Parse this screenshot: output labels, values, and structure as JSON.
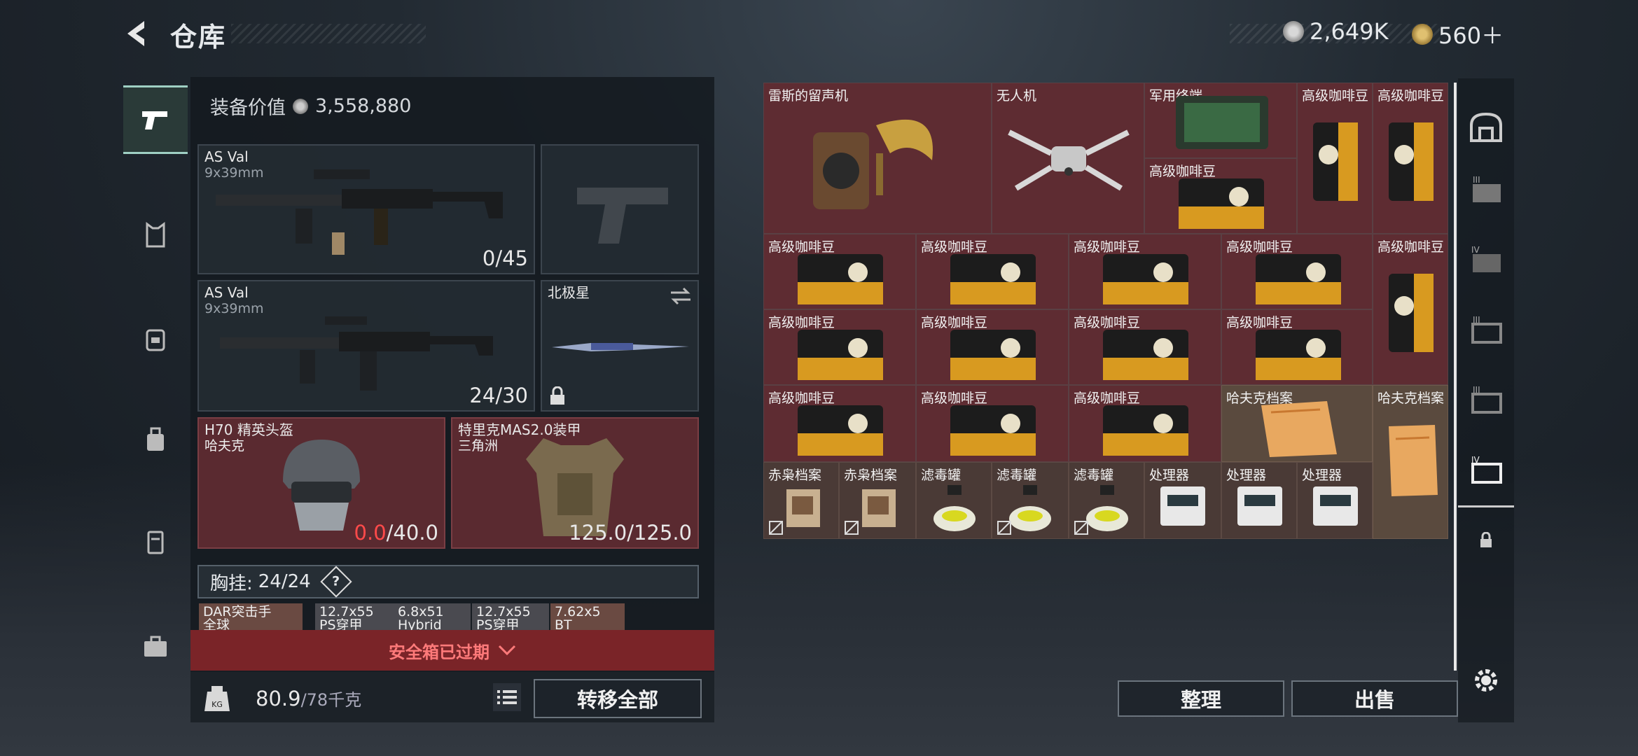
{
  "header": {
    "title": "仓库",
    "currency1": "2,649K",
    "currency2": "560＋"
  },
  "left": {
    "equip_label": "装备价值",
    "equip_value": "3,558,880",
    "weapon1": {
      "name": "AS Val",
      "caliber": "9x39mm",
      "ammo": "0/45"
    },
    "weapon2": {
      "name": "AS Val",
      "caliber": "9x39mm",
      "ammo": "24/30"
    },
    "melee": {
      "name": "北极星"
    },
    "helmet": {
      "name": "H70 精英头盔",
      "sub": "哈夫克",
      "dur_cur": "0.0",
      "dur_max": "/40.0"
    },
    "armor": {
      "name": "特里克MAS2.0装甲",
      "sub": "三角洲",
      "dur": "125.0/125.0"
    },
    "rig": {
      "label": "胸挂:",
      "count": "24/24",
      "help": "?"
    },
    "rig_items": [
      {
        "l1": "DAR突击手",
        "l2": "全球"
      },
      {
        "l1": "12.7x55",
        "l2": "PS穿甲"
      },
      {
        "l1": "6.8x51",
        "l2": "Hybrid"
      },
      {
        "l1": "12.7x55",
        "l2": "PS穿甲"
      },
      {
        "l1": "7.62x5",
        "l2": "BT"
      }
    ],
    "expired": "安全箱已过期",
    "weight": "80.9",
    "weight_max": "/78千克",
    "transfer_all": "转移全部"
  },
  "grid": {
    "items": [
      {
        "name": "雷斯的留声机",
        "kind": "gramophone"
      },
      {
        "name": "无人机",
        "kind": "drone"
      },
      {
        "name": "军用终端",
        "kind": "terminal"
      },
      {
        "name": "高级咖啡豆",
        "kind": "coffee"
      },
      {
        "name": "高级咖啡豆",
        "kind": "coffee"
      },
      {
        "name": "高级咖啡豆",
        "kind": "coffee"
      },
      {
        "name": "高级咖啡豆",
        "kind": "coffee"
      },
      {
        "name": "高级咖啡豆",
        "kind": "coffee"
      },
      {
        "name": "高级咖啡豆",
        "kind": "coffee"
      },
      {
        "name": "高级咖啡豆",
        "kind": "coffee"
      },
      {
        "name": "高级咖啡豆",
        "kind": "coffee"
      },
      {
        "name": "高级咖啡豆",
        "kind": "coffee"
      },
      {
        "name": "高级咖啡豆",
        "kind": "coffee"
      },
      {
        "name": "高级咖啡豆",
        "kind": "coffee"
      },
      {
        "name": "高级咖啡豆",
        "kind": "coffee"
      },
      {
        "name": "高级咖啡豆",
        "kind": "coffee"
      },
      {
        "name": "高级咖啡豆",
        "kind": "coffee"
      },
      {
        "name": "高级咖啡豆",
        "kind": "coffee"
      },
      {
        "name": "哈夫克档案",
        "kind": "file"
      },
      {
        "name": "哈夫克档案",
        "kind": "file"
      },
      {
        "name": "赤枭档案",
        "kind": "file2"
      },
      {
        "name": "赤枭档案",
        "kind": "file2"
      },
      {
        "name": "滤毒罐",
        "kind": "can"
      },
      {
        "name": "滤毒罐",
        "kind": "can"
      },
      {
        "name": "滤毒罐",
        "kind": "can"
      },
      {
        "name": "处理器",
        "kind": "cpu"
      },
      {
        "name": "处理器",
        "kind": "cpu"
      },
      {
        "name": "处理器",
        "kind": "cpu"
      }
    ]
  },
  "actions": {
    "sort": "整理",
    "sell": "出售"
  },
  "colors": {
    "item_bg": "#5e2c32",
    "accent_teal": "#9fd0c4",
    "expired_red": "#7a2428"
  }
}
